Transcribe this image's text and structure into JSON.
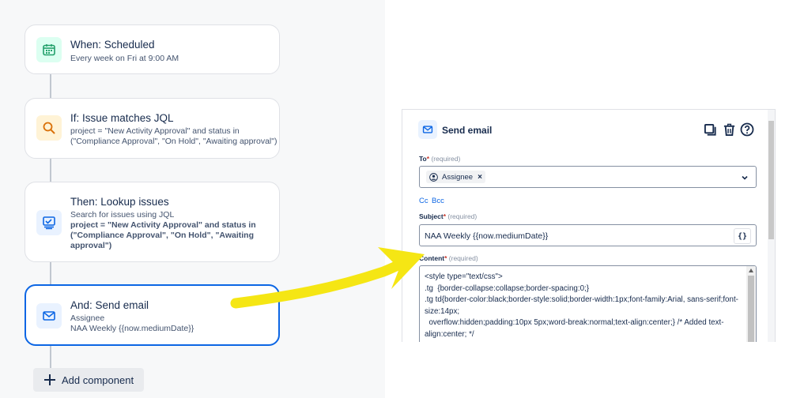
{
  "workflow": {
    "trigger": {
      "title": "When: Scheduled",
      "subtitle": "Every week on Fri at 9:00 AM",
      "icon": "calendar-icon",
      "color": "#22a06b"
    },
    "condition": {
      "title": "If: Issue matches JQL",
      "line1": "project = \"New Activity Approval\" and status in",
      "line2": "(\"Compliance Approval\", \"On Hold\", \"Awaiting approval\")",
      "icon": "search-icon",
      "color": "#d97008"
    },
    "lookup": {
      "title": "Then: Lookup issues",
      "subtitle": "Search for issues using JQL",
      "query": "project = \"New Activity Approval\" and status in (\"Compliance Approval\", \"On Hold\", \"Awaiting approval\")",
      "icon": "lookup-list-icon",
      "color": "#0c66e4"
    },
    "send_email": {
      "title": "And: Send email",
      "line1": "Assignee",
      "line2": "NAA Weekly {{now.mediumDate}}",
      "icon": "mail-icon",
      "color": "#0c66e4"
    },
    "add_component_label": "Add component"
  },
  "email_config": {
    "title": "Send email",
    "to": {
      "label": "To",
      "required_hint": "(required)",
      "chip_label": "Assignee"
    },
    "cc_label": "Cc",
    "bcc_label": "Bcc",
    "subject": {
      "label": "Subject",
      "required_hint": "(required)",
      "value": "NAA Weekly {{now.mediumDate}}",
      "smart_value_button": "{}"
    },
    "content": {
      "label": "Content",
      "required_hint": "(required)",
      "value": "<style type=\"text/css\">\n.tg  {border-collapse:collapse;border-spacing:0;}\n.tg td{border-color:black;border-style:solid;border-width:1px;font-family:Arial, sans-serif;font-size:14px;\n  overflow:hidden;padding:10px 5px;word-break:normal;text-align:center;} /* Added text-align:center; */"
    }
  },
  "colors": {
    "accent": "#0c66e4",
    "annotation_arrow": "#f5e614",
    "required": "#c9372c"
  }
}
